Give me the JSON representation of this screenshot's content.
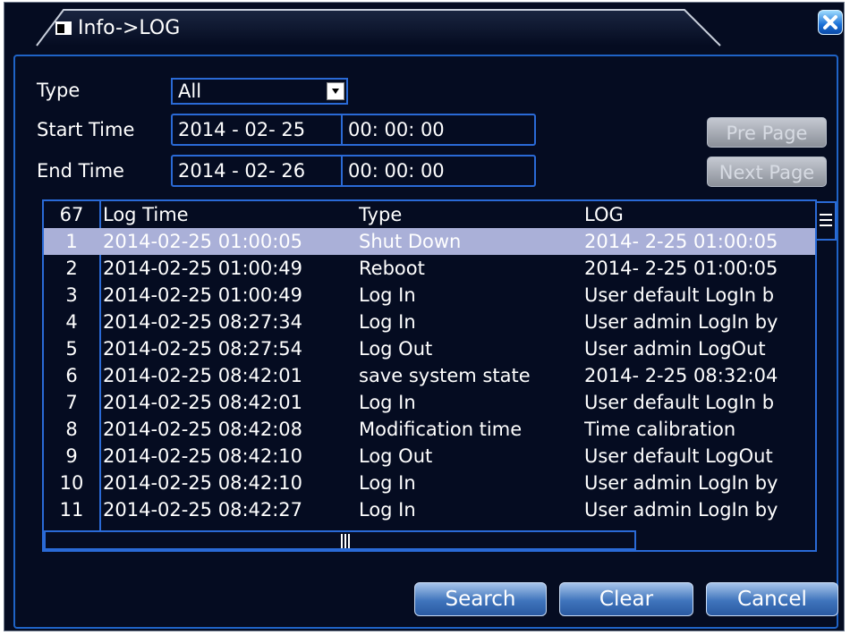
{
  "window": {
    "title": "Info->LOG"
  },
  "filters": {
    "type_label": "Type",
    "type_value": "All",
    "start_label": "Start Time",
    "start_date": "2014 - 02- 25",
    "start_time": "00: 00: 00",
    "end_label": "End Time",
    "end_date": "2014 - 02- 26",
    "end_time": "00: 00: 00"
  },
  "nav": {
    "prev_label": "Pre Page",
    "next_label": "Next Page"
  },
  "table": {
    "headers": [
      "67",
      "Log Time",
      "Type",
      "LOG"
    ],
    "rows": [
      [
        "1",
        "2014-02-25 01:00:05",
        "Shut Down",
        "2014- 2-25 01:00:05"
      ],
      [
        "2",
        "2014-02-25 01:00:49",
        "Reboot",
        "2014- 2-25 01:00:05"
      ],
      [
        "3",
        "2014-02-25 01:00:49",
        "Log In",
        "User default LogIn b"
      ],
      [
        "4",
        "2014-02-25 08:27:34",
        "Log In",
        "User admin LogIn by"
      ],
      [
        "5",
        "2014-02-25 08:27:54",
        "Log Out",
        "User admin LogOut"
      ],
      [
        "6",
        "2014-02-25 08:42:01",
        "save system state",
        "2014- 2-25 08:32:04"
      ],
      [
        "7",
        "2014-02-25 08:42:01",
        "Log In",
        "User default LogIn b"
      ],
      [
        "8",
        "2014-02-25 08:42:08",
        "Modification time",
        "Time calibration"
      ],
      [
        "9",
        "2014-02-25 08:42:10",
        "Log Out",
        "User default LogOut"
      ],
      [
        "10",
        "2014-02-25 08:42:10",
        "Log In",
        "User admin LogIn by"
      ],
      [
        "11",
        "2014-02-25 08:42:27",
        "Log In",
        "User admin LogIn by"
      ]
    ],
    "selected_row": 1
  },
  "actions": {
    "search_label": "Search",
    "clear_label": "Clear",
    "cancel_label": "Cancel"
  },
  "colors": {
    "background": "#050c21",
    "border": "#2a6ad6",
    "selection": "#aab0d8"
  }
}
